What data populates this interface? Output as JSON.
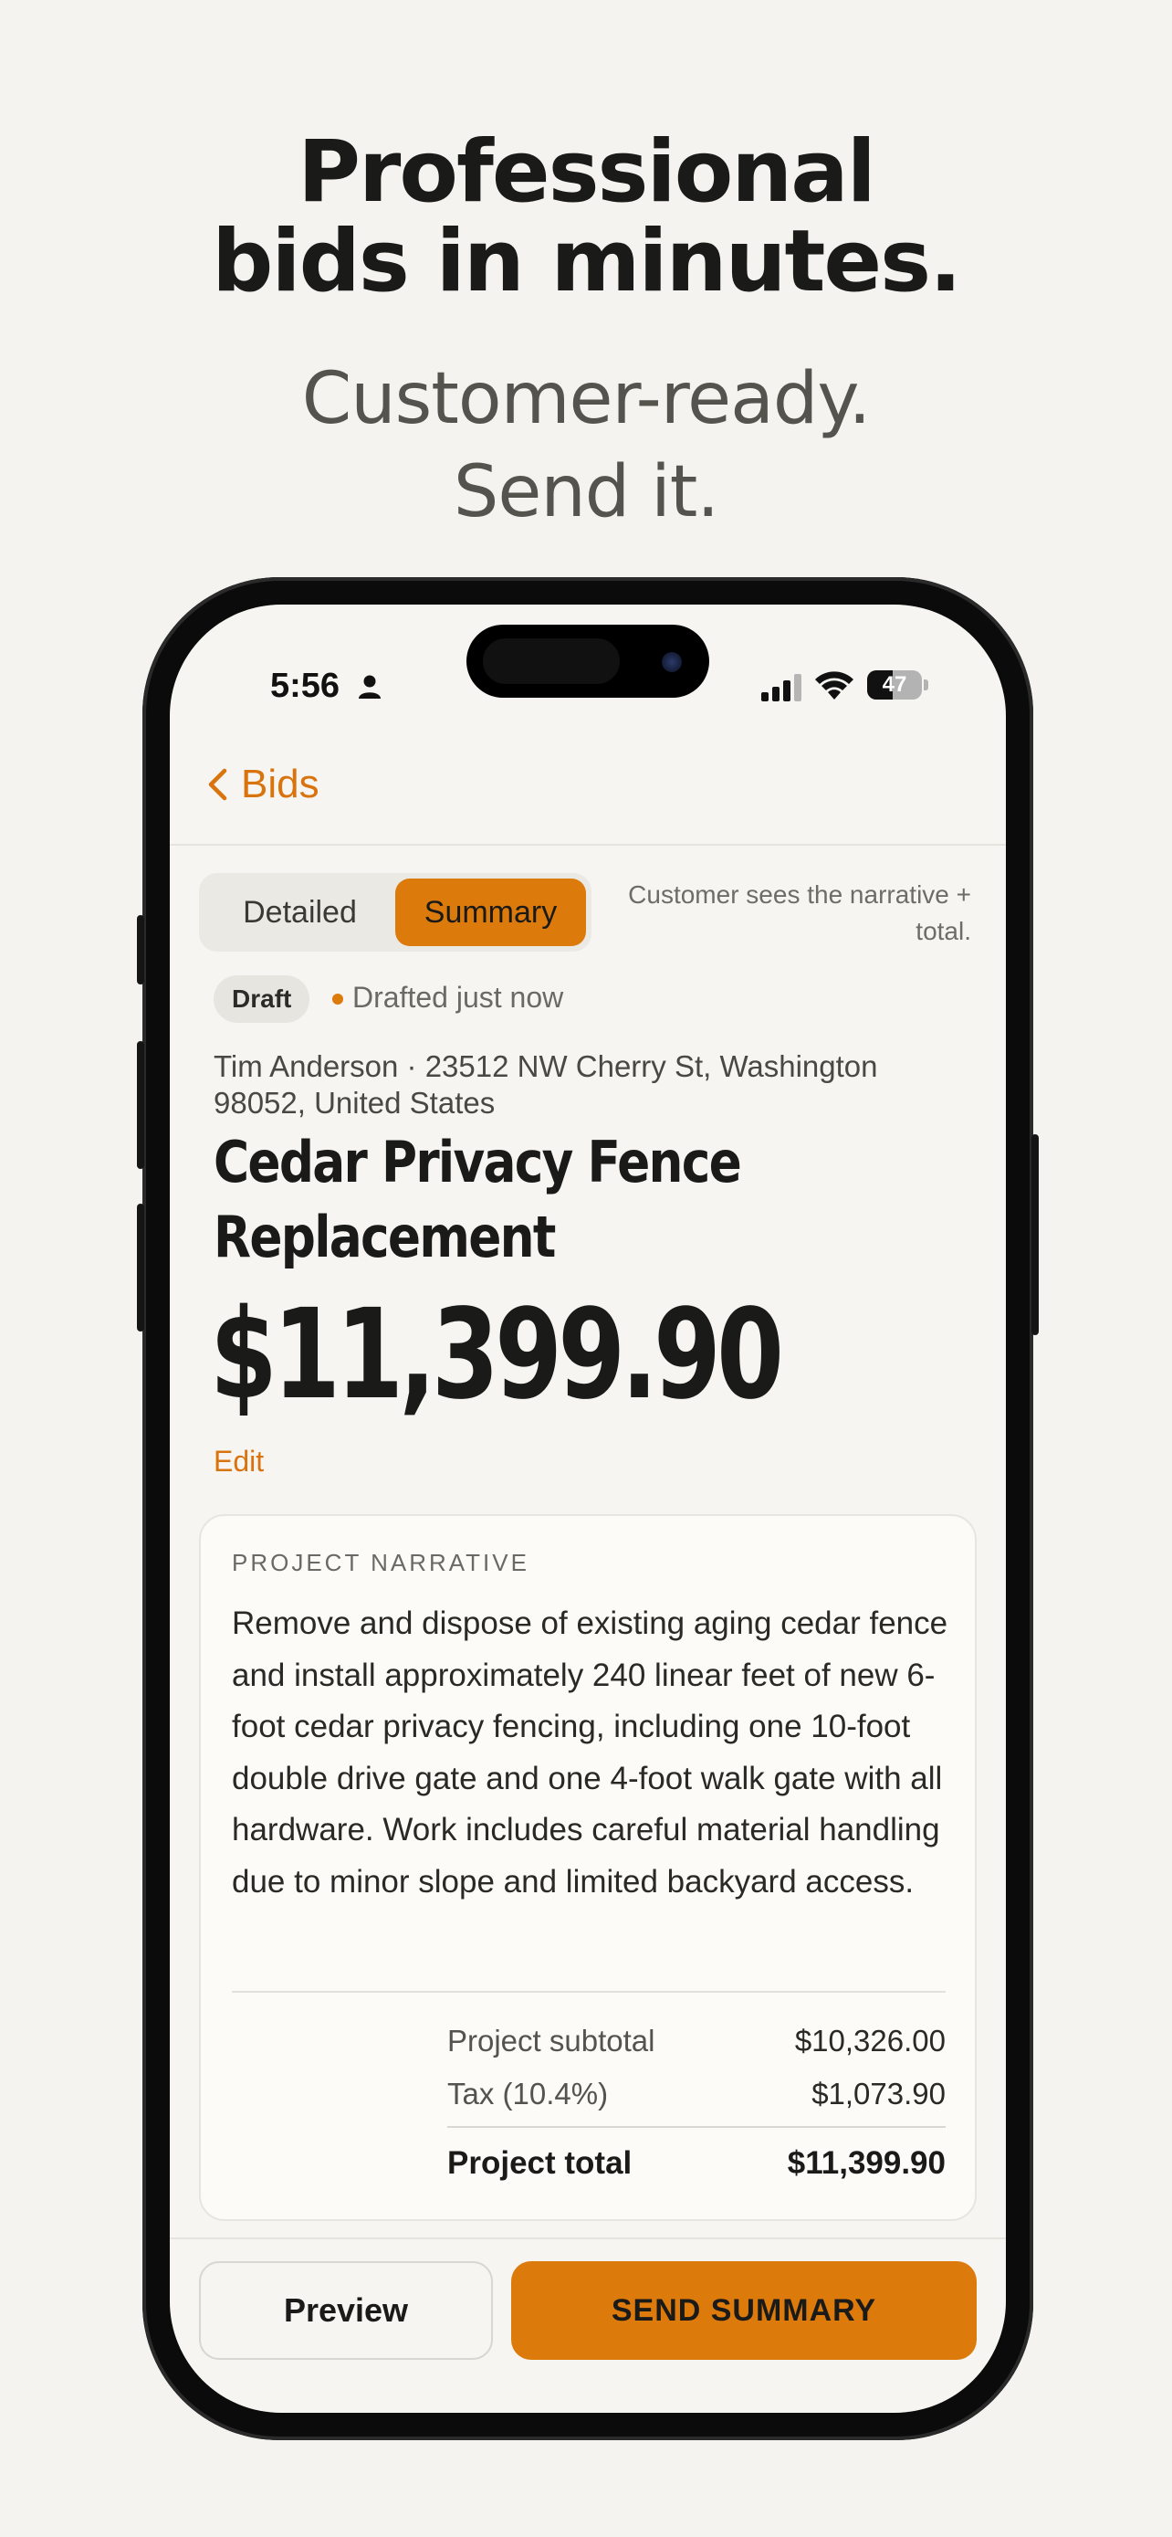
{
  "hero": {
    "title_line1": "Professional",
    "title_line2": "bids in minutes.",
    "subtitle_line1": "Customer-ready.",
    "subtitle_line2": "Send it."
  },
  "status_bar": {
    "time": "5:56",
    "battery": "47",
    "battery_level": 0.47
  },
  "nav": {
    "back_label": "Bids"
  },
  "view_toggle": {
    "options": [
      "Detailed",
      "Summary"
    ],
    "selected": "Summary",
    "hint": "Customer sees the narrative + total."
  },
  "bid": {
    "status": "Draft",
    "drafted": "Drafted just now",
    "customer": "Tim Anderson · 23512 NW Cherry St, Washington 98052, United States",
    "title": "Cedar Privacy Fence Replacement",
    "total": "$11,399.90",
    "edit_label": "Edit"
  },
  "narrative": {
    "label": "PROJECT NARRATIVE",
    "body": "Remove and dispose of existing aging cedar fence and install approximately 240 linear feet of new 6-foot cedar privacy fencing, including one 10-foot double drive gate and one 4-foot walk gate with all hardware. Work includes careful material handling due to minor slope and limited backyard access.",
    "subtotal_label": "Project subtotal",
    "subtotal_value": "$10,326.00",
    "tax_label": "Tax (10.4%)",
    "tax_value": "$1,073.90",
    "total_label": "Project total",
    "total_value": "$11,399.90"
  },
  "actions": {
    "preview_label": "Preview",
    "send_label": "SEND SUMMARY"
  },
  "colors": {
    "accent": "#dd7a0c",
    "background": "#f4f3ef"
  }
}
